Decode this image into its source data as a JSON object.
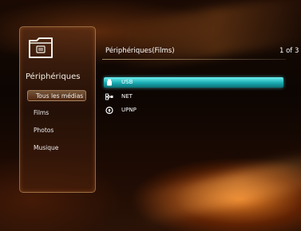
{
  "sidebar": {
    "title": "Périphériques",
    "items": [
      {
        "label": "Tous les médias",
        "selected": true
      },
      {
        "label": "Films",
        "selected": false
      },
      {
        "label": "Photos",
        "selected": false
      },
      {
        "label": "Musique",
        "selected": false
      }
    ],
    "icon": "folder-icon"
  },
  "header": {
    "title": "Périphériques(Films)",
    "page_indicator": "1 of 3"
  },
  "list": {
    "items": [
      {
        "label": "USB",
        "icon": "usb-icon",
        "selected": true
      },
      {
        "label": "NET",
        "icon": "network-icon",
        "selected": false
      },
      {
        "label": "UPNP",
        "icon": "upnp-icon",
        "selected": false
      }
    ]
  },
  "colors": {
    "selection": "#1ab0b6",
    "accent": "#ff8c28"
  }
}
